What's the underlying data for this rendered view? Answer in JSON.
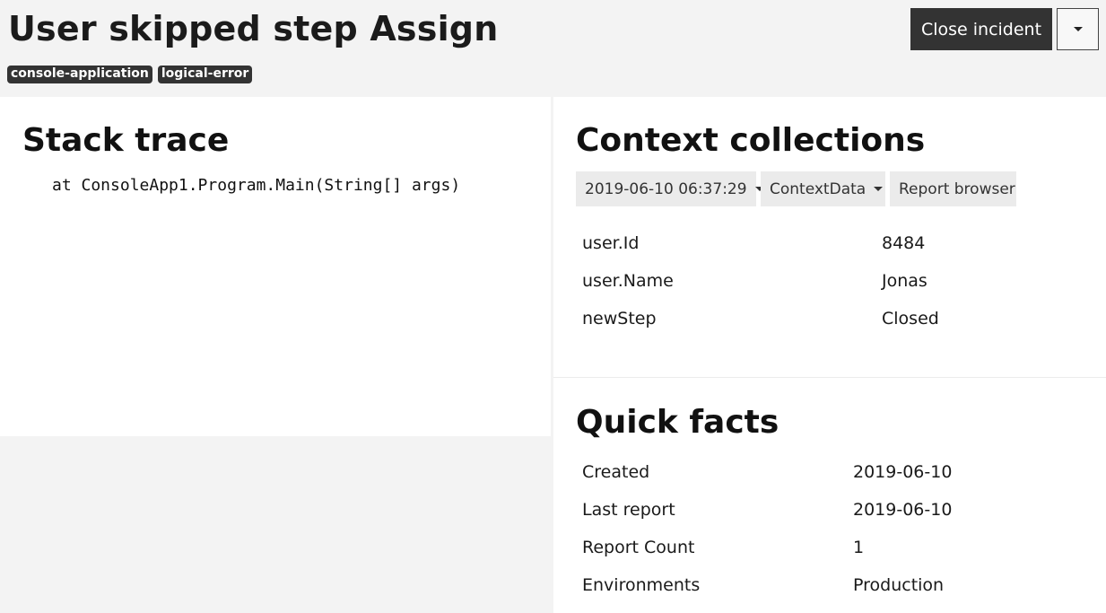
{
  "header": {
    "title": "User skipped step Assign",
    "tags": [
      "console-application",
      "logical-error"
    ],
    "close_label": "Close incident"
  },
  "stack": {
    "heading": "Stack trace",
    "lines": [
      "at ConsoleApp1.Program.Main(String[] args)"
    ]
  },
  "context": {
    "heading": "Context collections",
    "report_select": "2019-06-10 06:37:29",
    "collection_select": "ContextData",
    "browser_tab": "Report browser",
    "rows": [
      {
        "key": "user.Id",
        "value": "8484"
      },
      {
        "key": "user.Name",
        "value": "Jonas"
      },
      {
        "key": "newStep",
        "value": "Closed"
      }
    ]
  },
  "facts": {
    "heading": "Quick facts",
    "rows": [
      {
        "key": "Created",
        "value": "2019-06-10"
      },
      {
        "key": "Last report",
        "value": "2019-06-10"
      },
      {
        "key": "Report Count",
        "value": "1"
      },
      {
        "key": "Environments",
        "value": "Production"
      }
    ]
  }
}
